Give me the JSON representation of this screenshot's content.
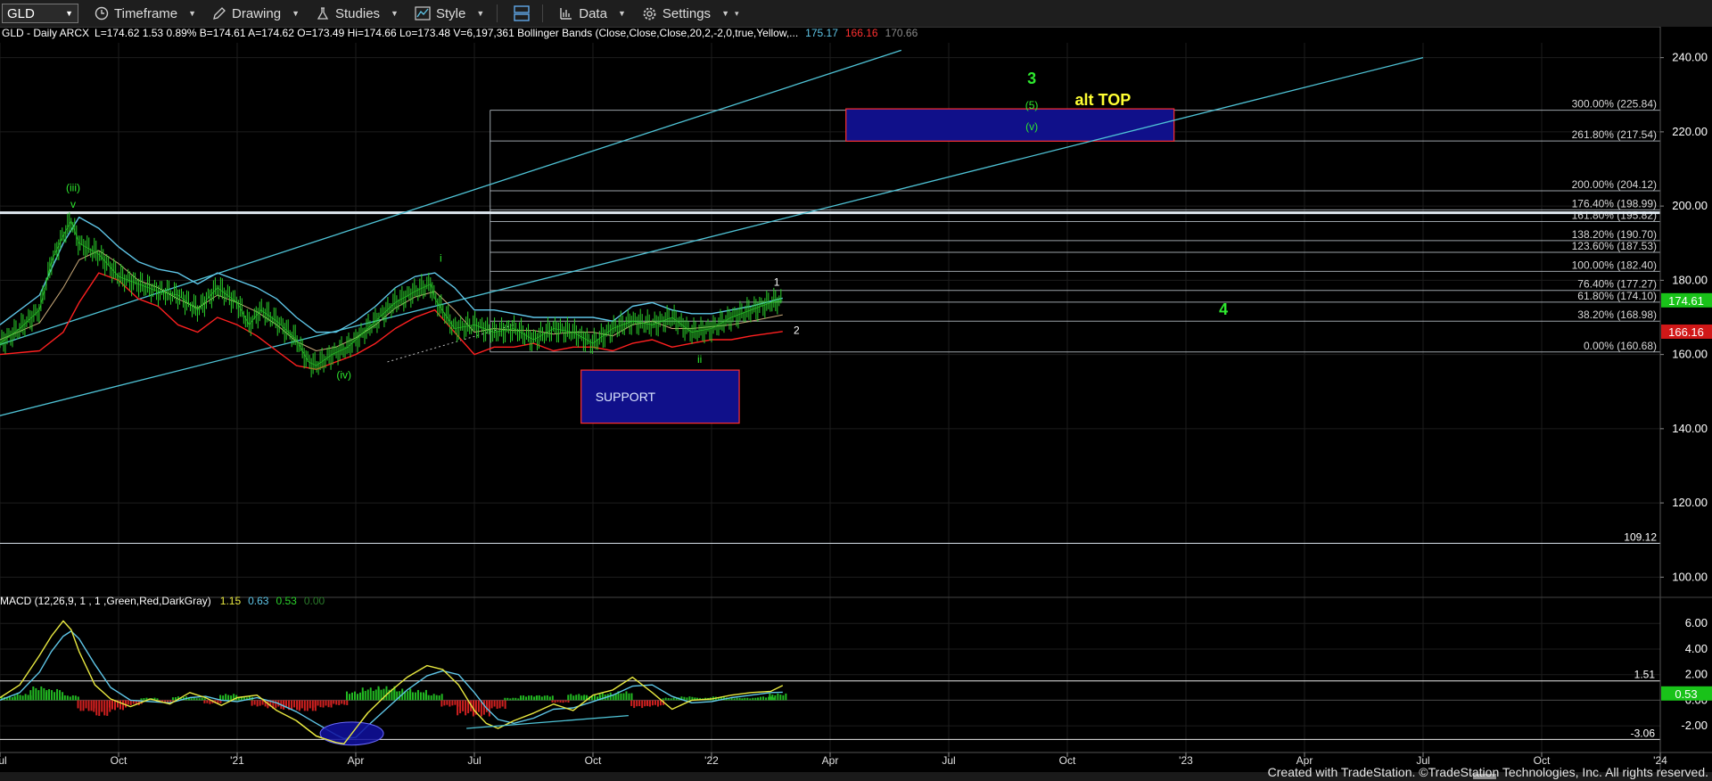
{
  "toolbar": {
    "symbol": "GLD",
    "items": [
      {
        "name": "timeframe",
        "label": "Timeframe",
        "icon": "clock-icon"
      },
      {
        "name": "drawing",
        "label": "Drawing",
        "icon": "pencil-icon"
      },
      {
        "name": "studies",
        "label": "Studies",
        "icon": "flask-icon"
      },
      {
        "name": "style",
        "label": "Style",
        "icon": "chart-style-icon"
      },
      {
        "name": "data",
        "label": "Data",
        "icon": "data-icon"
      },
      {
        "name": "settings",
        "label": "Settings",
        "icon": "gear-icon"
      }
    ]
  },
  "header": {
    "title": "GLD - Daily  ARCX",
    "quote": "L=174.62  1.53  0.89%  B=174.61  A=174.62  O=173.49  Hi=174.66  Lo=173.48  V=6,197,361  Bollinger Bands (Close,Close,Close,20,2,-2,0,true,Yellow,...",
    "bb_upper": "175.17",
    "bb_lower": "166.16",
    "bb_mid": "170.66"
  },
  "macd_header": {
    "label": "MACD (12,26,9, 1 , 1 ,Green,Red,DarkGray)",
    "v1": "1.15",
    "v2": "0.63",
    "v3": "0.53",
    "v4": "0.00"
  },
  "footer": "Created with TradeStation. ©TradeStation Technologies, Inc. All rights reserved.",
  "colors": {
    "background": "#000000",
    "price_bars": "#2bd12b",
    "bb_upper": "#5fc6e8",
    "bb_lower": "#ff2020",
    "bb_mid": "#c8a878",
    "trend": "#4fc3d6",
    "fib": "#cfd8e0",
    "box_fill": "#10108a",
    "box_border": "#ff3030",
    "label_green": "#2ee82e",
    "label_yellow": "#ffff33",
    "macd_line": "#e8e840",
    "macd_signal": "#5fc6e8"
  },
  "chart_data": {
    "type": "candlestick-daily",
    "symbol": "GLD",
    "x_ticks": [
      "Jul",
      "Oct",
      "'21",
      "Apr",
      "Jul",
      "Oct",
      "'22",
      "Apr",
      "Jul",
      "Oct",
      "'23",
      "Apr",
      "Jul",
      "Oct",
      "'24"
    ],
    "x_range_months": [
      0,
      42
    ],
    "price_axis": {
      "ylim": [
        96,
        244
      ],
      "ticks": [
        "100.00",
        "120.00",
        "140.00",
        "160.00",
        "180.00",
        "200.00",
        "220.00",
        "240.00"
      ]
    },
    "macd_axis": {
      "ylim": [
        -3.8,
        7.2
      ],
      "ticks": [
        "-2.00",
        "0.00",
        "2.00",
        "4.00",
        "6.00"
      ]
    },
    "price_series": {
      "name": "GLD",
      "x": [
        0,
        0.5,
        1,
        1.3,
        1.6,
        1.8,
        2,
        2.5,
        3,
        3.5,
        4,
        4.5,
        5,
        5.5,
        6,
        6.3,
        6.6,
        7,
        7.5,
        7.8,
        8,
        8.4,
        8.8,
        9.2,
        9.6,
        10,
        10.5,
        10.9,
        11,
        11.5,
        12,
        12.5,
        13,
        13.5,
        14,
        14.5,
        15,
        15.5,
        16,
        16.5,
        17,
        17.5,
        18,
        18.5,
        19,
        19.5,
        19.8
      ],
      "y": [
        163,
        167,
        172,
        185,
        192,
        196,
        190,
        187,
        181,
        179,
        177,
        176,
        172,
        178,
        174,
        168,
        172,
        169,
        164,
        158,
        157,
        160,
        162,
        166,
        170,
        174,
        177,
        179,
        175,
        167,
        168,
        166,
        167,
        164,
        167,
        166,
        163,
        167,
        169,
        168,
        170,
        166,
        167,
        170,
        172,
        174,
        174.6
      ]
    },
    "bb_upper_series": {
      "x": [
        0,
        1,
        1.6,
        2,
        2.5,
        3,
        3.5,
        4,
        4.5,
        5,
        5.5,
        6,
        6.5,
        7,
        7.5,
        8,
        8.5,
        9,
        9.5,
        10,
        10.5,
        11,
        11.5,
        12,
        12.5,
        13,
        13.5,
        14,
        14.5,
        15,
        15.5,
        16,
        16.5,
        17,
        17.5,
        18,
        18.5,
        19,
        19.8
      ],
      "y": [
        168,
        176,
        190,
        197,
        194,
        189,
        185,
        183,
        182,
        179,
        182,
        180,
        178,
        175,
        170,
        166,
        166,
        169,
        173,
        178,
        181,
        182,
        178,
        172,
        172,
        171,
        170,
        170,
        170,
        170,
        169,
        173,
        174,
        172,
        171,
        171,
        172,
        173,
        175.2
      ]
    },
    "bb_lower_series": {
      "x": [
        0,
        1,
        1.6,
        2,
        2.5,
        3,
        3.5,
        4,
        4.5,
        5,
        5.5,
        6,
        6.5,
        7,
        7.5,
        8,
        8.5,
        9,
        9.5,
        10,
        10.5,
        11,
        11.5,
        12,
        12.5,
        13,
        13.5,
        14,
        14.5,
        15,
        15.5,
        16,
        16.5,
        17,
        17.5,
        18,
        18.5,
        19,
        19.8
      ],
      "y": [
        160,
        161,
        166,
        174,
        182,
        180,
        175,
        173,
        168,
        166,
        170,
        168,
        165,
        161,
        157,
        156,
        158,
        160,
        163,
        167,
        170,
        172,
        166,
        160,
        162,
        162,
        163,
        161,
        162,
        162,
        161,
        163,
        164,
        162,
        163,
        164,
        164,
        165,
        166.2
      ]
    },
    "fib_levels": [
      {
        "label": "300.00% (225.84)",
        "value": 225.84
      },
      {
        "label": "261.80% (217.54)",
        "value": 217.54
      },
      {
        "label": "200.00% (204.12)",
        "value": 204.12
      },
      {
        "label": "176.40% (198.99)",
        "value": 198.99
      },
      {
        "label": "161.80% (195.82)",
        "value": 195.82
      },
      {
        "label": "138.20% (190.70)",
        "value": 190.7
      },
      {
        "label": "123.60% (187.53)",
        "value": 187.53
      },
      {
        "label": "100.00% (182.40)",
        "value": 182.4
      },
      {
        "label": "76.40% (177.27)",
        "value": 177.27
      },
      {
        "label": "61.80% (174.10)",
        "value": 174.1
      },
      {
        "label": "38.20% (168.98)",
        "value": 168.98
      },
      {
        "label": "0.00% (160.68)",
        "value": 160.68
      }
    ],
    "fib_x_start": 12.4,
    "horizontal_lines": [
      {
        "value": 198.2
      },
      {
        "value": 109.12,
        "label": "109.12"
      }
    ],
    "trend_channel": [
      {
        "x1": -0.2,
        "y1": 162,
        "x2": 22.8,
        "y2": 242
      },
      {
        "x1": -0.2,
        "y1": 143,
        "x2": 36,
        "y2": 240
      }
    ],
    "dotted_line": {
      "x1": 9.8,
      "y1": 158,
      "x2": 13,
      "y2": 168
    },
    "boxes": [
      {
        "label": "SUPPORT",
        "x1": 14.7,
        "x2": 18.7,
        "y1": 155.8,
        "y2": 141.5
      },
      {
        "label": "",
        "x1": 21.4,
        "x2": 29.7,
        "y1": 226.2,
        "y2": 217.5
      }
    ],
    "annotations": [
      {
        "text": "(iii)",
        "x": 1.85,
        "y": 204,
        "color": "green",
        "size": 12
      },
      {
        "text": "v",
        "x": 1.85,
        "y": 199.5,
        "color": "green",
        "size": 12
      },
      {
        "text": "(iv)",
        "x": 8.7,
        "y": 153.5,
        "color": "green",
        "size": 12
      },
      {
        "text": "i",
        "x": 11.15,
        "y": 185,
        "color": "green",
        "size": 12
      },
      {
        "text": "ii",
        "x": 17.7,
        "y": 157.8,
        "color": "green",
        "size": 12
      },
      {
        "text": "1",
        "x": 19.65,
        "y": 178.5,
        "color": "white",
        "size": 12
      },
      {
        "text": "2",
        "x": 20.15,
        "y": 165.5,
        "color": "white",
        "size": 12
      },
      {
        "text": "3",
        "x": 26.1,
        "y": 233,
        "color": "green",
        "size": 18
      },
      {
        "text": "(5)",
        "x": 26.1,
        "y": 226.2,
        "color": "green",
        "size": 12
      },
      {
        "text": "(v)",
        "x": 26.1,
        "y": 220.4,
        "color": "green",
        "size": 12
      },
      {
        "text": "alt TOP",
        "x": 27.9,
        "y": 227.2,
        "color": "yellow",
        "size": 18
      },
      {
        "text": "4",
        "x": 30.95,
        "y": 170.7,
        "color": "green",
        "size": 18
      }
    ],
    "price_tags": [
      {
        "value": 174.61,
        "label": "174.61",
        "color": "#19c219"
      },
      {
        "value": 166.16,
        "label": "166.16",
        "color": "#d01818"
      }
    ],
    "macd_series": {
      "name": "MACD",
      "x": [
        0,
        0.5,
        1,
        1.3,
        1.6,
        1.8,
        2,
        2.4,
        2.8,
        3.3,
        3.8,
        4.3,
        4.8,
        5.2,
        5.6,
        6,
        6.5,
        7,
        7.5,
        8,
        8.5,
        8.7,
        9,
        9.3,
        9.8,
        10.3,
        10.8,
        11.2,
        11.6,
        12,
        12.3,
        12.6,
        13,
        13.5,
        14,
        14.5,
        15,
        15.5,
        16,
        16.5,
        17,
        17.5,
        18,
        18.5,
        19,
        19.5,
        19.8
      ],
      "y": [
        0.2,
        1.2,
        3.5,
        5.0,
        6.2,
        5.5,
        3.8,
        1.2,
        0.1,
        -0.5,
        0.1,
        -0.3,
        0.6,
        0.2,
        -0.4,
        0.2,
        0.4,
        -0.8,
        -1.6,
        -2.8,
        -3.3,
        -3.4,
        -2.2,
        -1.0,
        0.5,
        1.8,
        2.7,
        2.4,
        1.2,
        -0.8,
        -1.8,
        -2.2,
        -1.6,
        -1.0,
        -0.3,
        -0.8,
        0.4,
        0.8,
        1.8,
        0.6,
        -0.7,
        0.0,
        0.1,
        0.4,
        0.6,
        0.7,
        1.15
      ]
    },
    "macd_signal_series": {
      "name": "Signal",
      "x": [
        0,
        0.5,
        1,
        1.3,
        1.6,
        1.8,
        2,
        2.4,
        2.8,
        3.3,
        3.8,
        4.3,
        4.8,
        5.2,
        5.6,
        6,
        6.5,
        7,
        7.5,
        8,
        8.5,
        8.7,
        9,
        9.3,
        9.8,
        10.3,
        10.8,
        11.2,
        11.6,
        12,
        12.3,
        12.6,
        13,
        13.5,
        14,
        14.5,
        15,
        15.5,
        16,
        16.5,
        17,
        17.5,
        18,
        18.5,
        19,
        19.5,
        19.8
      ],
      "y": [
        0.0,
        0.6,
        2.2,
        3.8,
        5.0,
        5.4,
        4.8,
        2.8,
        1.0,
        0.0,
        -0.1,
        -0.2,
        0.2,
        0.3,
        0.0,
        -0.1,
        0.2,
        -0.2,
        -0.9,
        -1.8,
        -2.7,
        -3.0,
        -2.9,
        -2.0,
        -0.6,
        0.8,
        1.9,
        2.3,
        2.0,
        0.6,
        -0.6,
        -1.5,
        -1.8,
        -1.4,
        -0.7,
        -0.6,
        -0.1,
        0.4,
        1.1,
        1.2,
        0.3,
        -0.2,
        -0.1,
        0.2,
        0.4,
        0.6,
        0.63
      ]
    },
    "macd_histogram": {
      "name": "Histogram",
      "x": [
        0.2,
        0.6,
        1.0,
        1.4,
        1.8,
        2.2,
        2.6,
        3.0,
        3.4,
        3.8,
        4.2,
        4.6,
        5.0,
        5.4,
        5.8,
        6.2,
        6.6,
        7.0,
        7.4,
        7.8,
        8.2,
        8.6,
        9.0,
        9.4,
        9.8,
        10.2,
        10.6,
        11.0,
        11.4,
        11.8,
        12.2,
        12.6,
        13.0,
        13.4,
        13.8,
        14.2,
        14.6,
        15.0,
        15.4,
        15.8,
        16.2,
        16.6,
        17.0,
        17.4,
        17.8,
        18.2,
        18.6,
        19.0,
        19.4,
        19.7
      ],
      "y": [
        0.3,
        0.5,
        1.1,
        0.9,
        0.4,
        -0.9,
        -1.3,
        -0.8,
        -0.4,
        0.2,
        -0.2,
        0.3,
        0.2,
        -0.3,
        0.5,
        0.3,
        -0.5,
        -0.7,
        -0.8,
        -0.9,
        -0.6,
        -0.4,
        0.7,
        1.0,
        1.1,
        0.9,
        0.8,
        0.5,
        -0.5,
        -1.2,
        -1.3,
        -0.7,
        0.2,
        0.4,
        0.4,
        -0.2,
        0.5,
        0.4,
        0.6,
        0.7,
        -0.6,
        -0.5,
        0.2,
        0.3,
        0.2,
        0.3,
        0.2,
        0.2,
        0.3,
        0.53
      ]
    },
    "macd_levels": [
      {
        "value": 1.51,
        "label": "1.51"
      },
      {
        "value": -3.06,
        "label": "-3.06"
      }
    ],
    "macd_tag": {
      "value": 0.53,
      "label": "0.53",
      "color": "#19c219"
    },
    "macd_ellipse": {
      "cx": 8.9,
      "cy": -2.6,
      "rx": 0.8,
      "ry": 0.9
    },
    "macd_trend": {
      "x1": 11.8,
      "y1": -2.2,
      "x2": 15.9,
      "y2": -1.2
    }
  }
}
